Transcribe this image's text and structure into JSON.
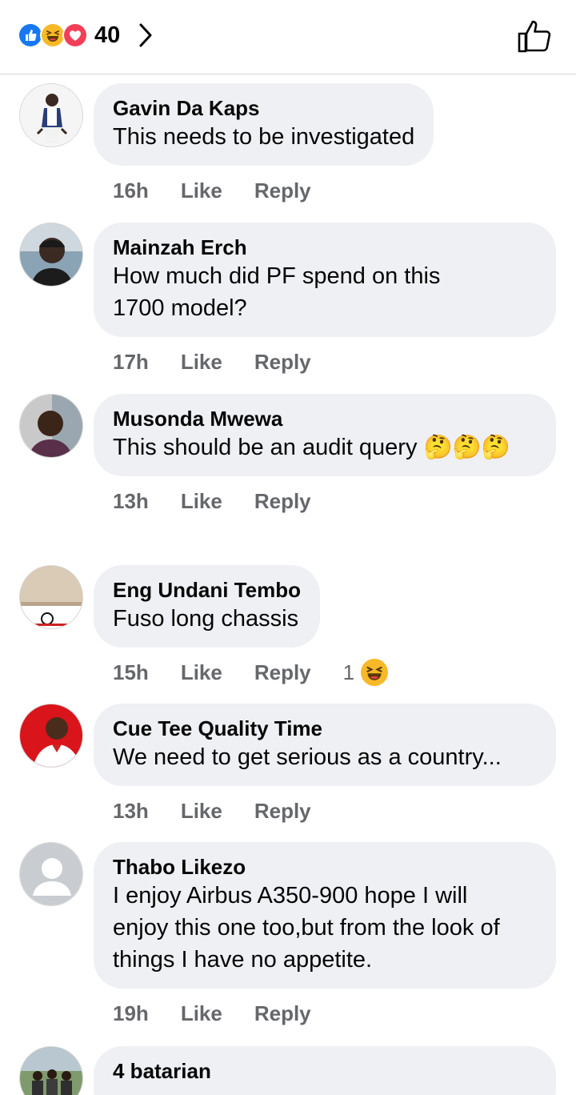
{
  "header": {
    "reaction_count": "40",
    "reaction_icons": [
      "like-icon",
      "haha-icon",
      "love-icon"
    ],
    "colors": {
      "like": "#1877f2",
      "haha": "#f7b928",
      "love": "#f33e58"
    }
  },
  "actions": {
    "like_label": "Like",
    "reply_label": "Reply"
  },
  "comments": [
    {
      "name": "Gavin Da Kaps",
      "text": "This needs to be investigated",
      "time": "16h"
    },
    {
      "name": "Mainzah Erch",
      "text": "How much did PF spend on this 1700 model?",
      "time": "17h"
    },
    {
      "name": "Musonda Mwewa",
      "text": "This should be an audit query 🤔🤔🤔",
      "time": "13h"
    },
    {
      "name": "Eng Undani Tembo",
      "text": "Fuso long chassis",
      "time": "15h",
      "reactions": "1"
    },
    {
      "name": "Cue Tee Quality Time",
      "text": "We need to get serious as a country...",
      "time": "13h"
    },
    {
      "name": "Thabo Likezo",
      "text": "I enjoy Airbus A350-900 hope I will enjoy this one too,but from the look of things I have no appetite.",
      "time": "19h"
    },
    {
      "name": "4 batarian",
      "text": ""
    }
  ]
}
